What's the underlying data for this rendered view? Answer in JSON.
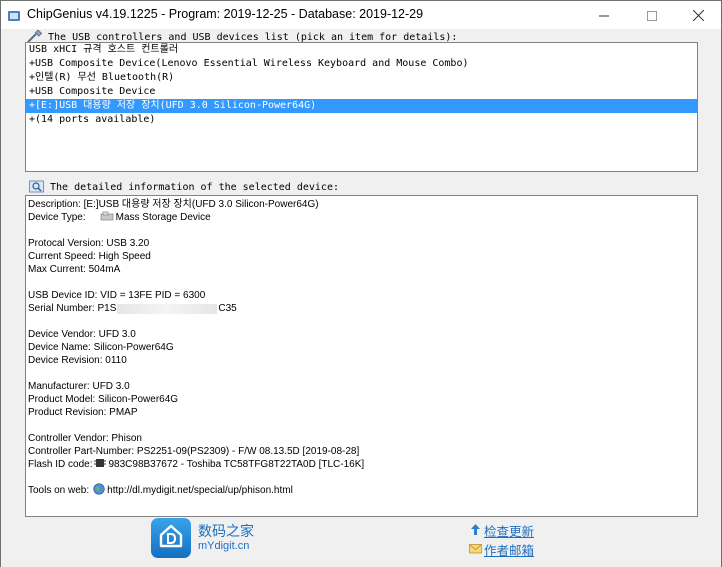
{
  "window": {
    "title": "ChipGenius v4.19.1225 - Program: 2019-12-25 - Database: 2019-12-29"
  },
  "device_list": {
    "label": "The USB controllers and USB devices list (pick an item for details):",
    "items": [
      {
        "text": "USB xHCI 규격 호스트 컨트롤러",
        "selected": false
      },
      {
        "text": "+USB Composite Device(Lenovo Essential Wireless Keyboard and Mouse Combo)",
        "selected": false
      },
      {
        "text": "+인텔(R) 무선 Bluetooth(R)",
        "selected": false
      },
      {
        "text": "+USB Composite Device",
        "selected": false
      },
      {
        "text": "+[E:]USB 대용량 저장 장치(UFD 3.0 Silicon-Power64G)",
        "selected": true
      },
      {
        "text": "+(14 ports available)",
        "selected": false
      }
    ]
  },
  "details": {
    "label": "The detailed information of the selected device:",
    "description": "Description: [E:]USB 대용량 저장 장치(UFD 3.0 Silicon-Power64G)",
    "device_type_label": "Device Type:",
    "device_type_value": "Mass Storage Device",
    "protocol_version": "Protocal Version: USB 3.20",
    "current_speed": "Current Speed: High Speed",
    "max_current": "Max Current: 504mA",
    "usb_device_id": "USB Device ID: VID = 13FE PID = 6300",
    "serial_prefix": "Serial Number: P1S",
    "serial_suffix": "C35",
    "device_vendor": "Device Vendor: UFD 3.0",
    "device_name": "Device Name: Silicon-Power64G",
    "device_revision": "Device Revision: 0110",
    "manufacturer": "Manufacturer: UFD 3.0",
    "product_model": "Product Model: Silicon-Power64G",
    "product_revision": "Product Revision: PMAP",
    "controller_vendor": "Controller Vendor: Phison",
    "controller_part": "Controller Part-Number: PS2251-09(PS2309) - F/W 08.13.5D [2019-08-28]",
    "flash_id_label": "Flash ID code:",
    "flash_id_value": "983C98B37672 - Toshiba TC58TFG8T22TA0D [TLC-16K]",
    "tools_label": "Tools on web:",
    "tools_url": "http://dl.mydigit.net/special/up/phison.html"
  },
  "footer": {
    "logo_cn": "数码之家",
    "logo_en": "mYdigit.cn",
    "check_update": "检查更新",
    "author_mail": "作者邮箱"
  },
  "colors": {
    "selection": "#3399ff",
    "link": "#1c6fc1"
  }
}
